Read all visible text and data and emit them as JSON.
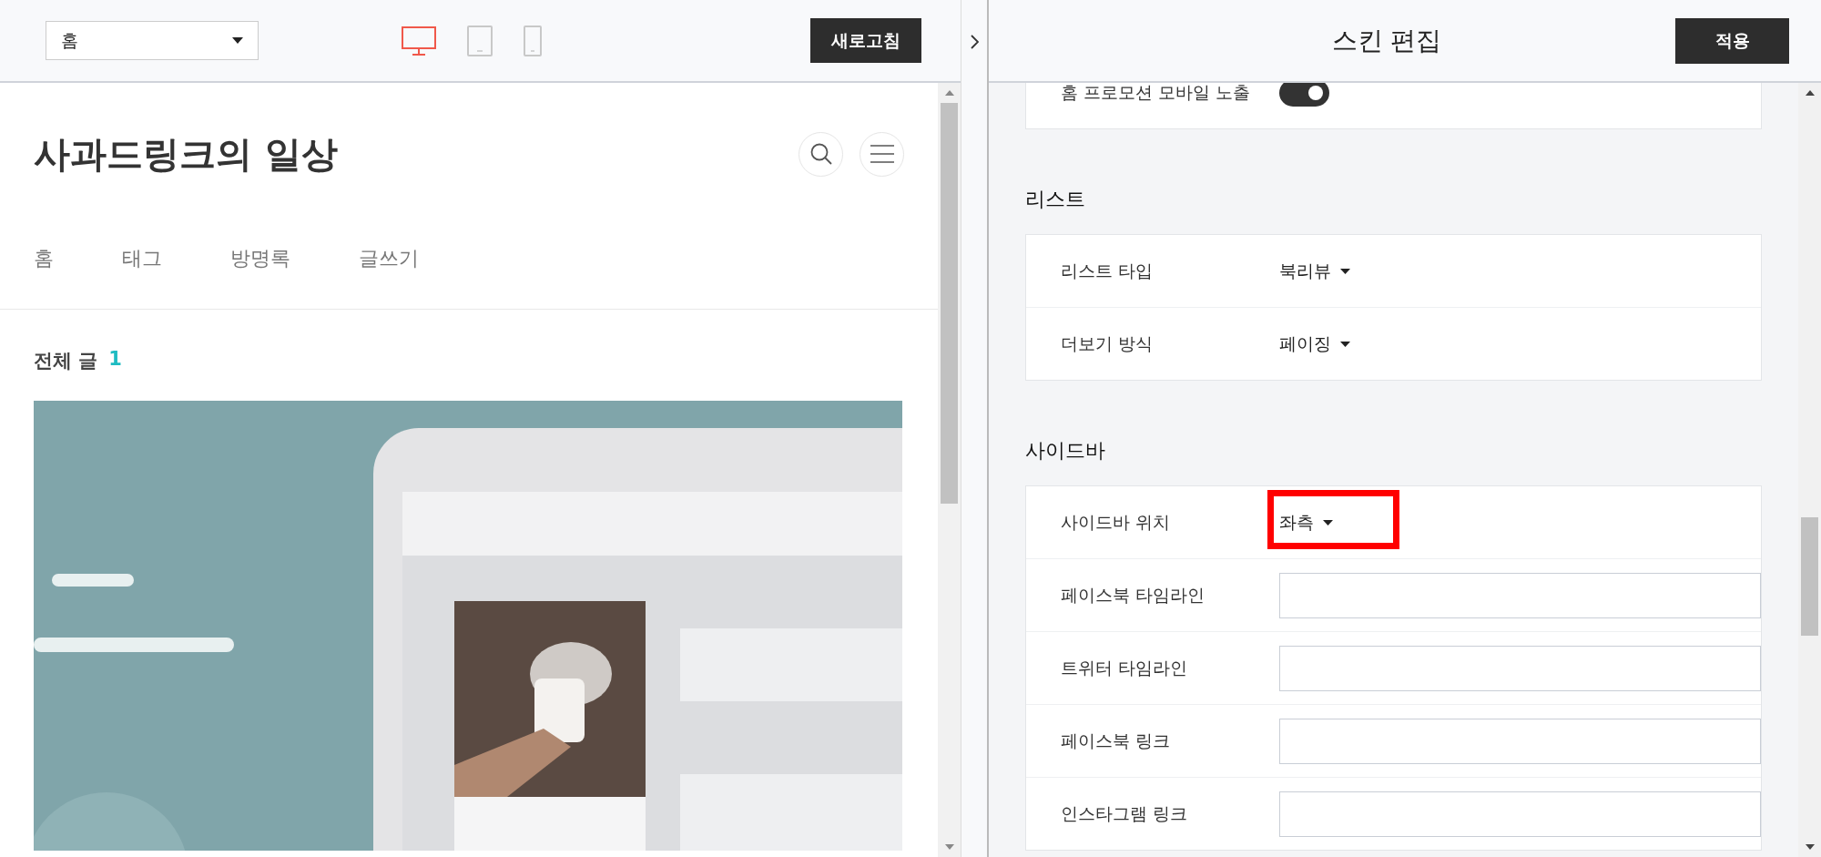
{
  "preview": {
    "page_select": {
      "value": "홈"
    },
    "devices": [
      {
        "kind": "desktop",
        "selected": true
      },
      {
        "kind": "tablet",
        "selected": false
      },
      {
        "kind": "mobile",
        "selected": false
      }
    ],
    "refresh_button": "새로고침",
    "blog": {
      "title": "사과드링크의 일상",
      "nav": [
        "홈",
        "태그",
        "방명록",
        "글쓰기"
      ],
      "post_count_label": "전체 글",
      "post_count": "1",
      "banner": {
        "kind": "picture"
      }
    }
  },
  "editor": {
    "title": "스킨 편집",
    "apply_button": "적용",
    "sections": [
      {
        "rows": [
          {
            "kind": "toggle",
            "label": "홈 프로모션 모바일 노출",
            "on": true
          }
        ]
      },
      {
        "heading": "리스트",
        "rows": [
          {
            "kind": "select",
            "label": "리스트 타입",
            "value": "북리뷰",
            "highlighted": false
          },
          {
            "kind": "select",
            "label": "더보기 방식",
            "value": "페이징",
            "highlighted": false
          }
        ]
      },
      {
        "heading": "사이드바",
        "rows": [
          {
            "kind": "select",
            "label": "사이드바 위치",
            "value": "좌측",
            "highlighted": true
          },
          {
            "kind": "text",
            "label": "페이스북 타임라인"
          },
          {
            "kind": "text",
            "label": "트위터 타임라인"
          },
          {
            "kind": "text",
            "label": "페이스북 링크"
          },
          {
            "kind": "text",
            "label": "인스타그램 링크"
          }
        ]
      }
    ]
  }
}
